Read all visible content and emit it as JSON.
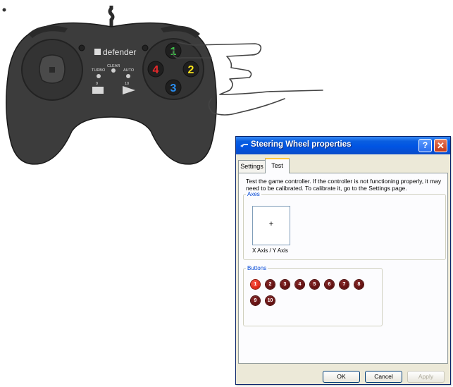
{
  "controller": {
    "brand": "defender",
    "labels": {
      "clear": "CLEAR",
      "turbo": "TURBO",
      "auto": "AUTO",
      "left_num": "9",
      "right_num": "10"
    },
    "face_buttons": [
      {
        "label": "1",
        "color": "#3fc24a"
      },
      {
        "label": "2",
        "color": "#f7e11c"
      },
      {
        "label": "3",
        "color": "#2a8ef0"
      },
      {
        "label": "4",
        "color": "#e8282a"
      }
    ]
  },
  "dialog": {
    "title": "Steering Wheel properties",
    "help_glyph": "?",
    "close_glyph": "✕",
    "tabs": [
      {
        "label": "Settings"
      },
      {
        "label": "Test"
      }
    ],
    "active_tab": "Test",
    "description": "Test the game controller.  If the controller is not functioning properly, it may need to be calibrated.  To calibrate it, go to the Settings page.",
    "axes": {
      "legend": "Axes",
      "cursor": "+",
      "label": "X Axis / Y Axis"
    },
    "buttons": {
      "legend": "Buttons",
      "items": [
        {
          "label": "1",
          "pressed": true
        },
        {
          "label": "2",
          "pressed": false
        },
        {
          "label": "3",
          "pressed": false
        },
        {
          "label": "4",
          "pressed": false
        },
        {
          "label": "5",
          "pressed": false
        },
        {
          "label": "6",
          "pressed": false
        },
        {
          "label": "7",
          "pressed": false
        },
        {
          "label": "8",
          "pressed": false
        },
        {
          "label": "9",
          "pressed": false
        },
        {
          "label": "10",
          "pressed": false
        }
      ]
    },
    "footer": {
      "ok": "OK",
      "cancel": "Cancel",
      "apply": "Apply"
    }
  },
  "colors": {
    "title_bar": "#0054e3",
    "pressed_button": "#d81e0c",
    "tab_highlight": "#ffc83c"
  }
}
